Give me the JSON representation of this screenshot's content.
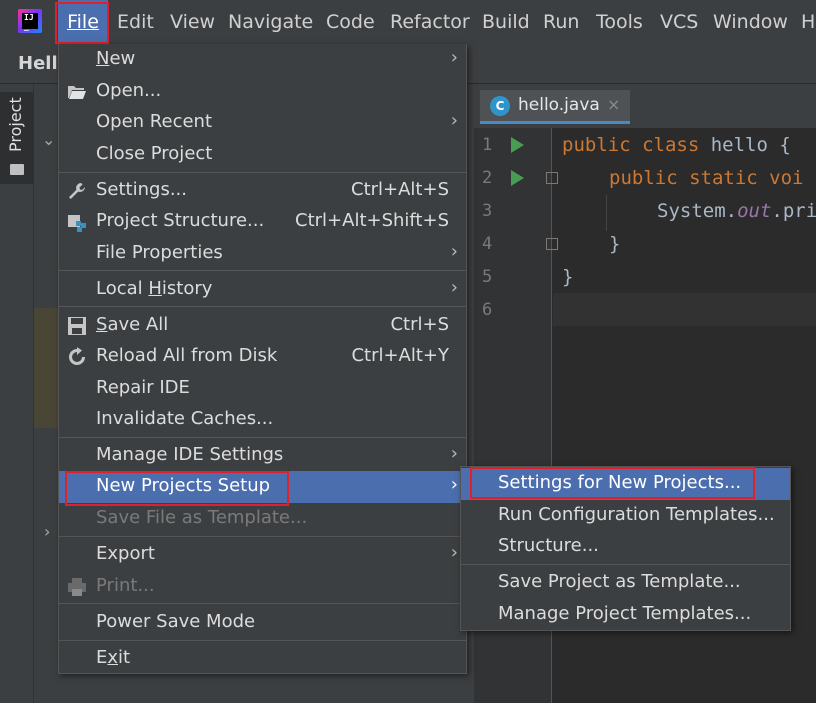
{
  "menubar": {
    "items": [
      {
        "label": "File",
        "mnemonic": "F"
      },
      {
        "label": "Edit"
      },
      {
        "label": "View"
      },
      {
        "label": "Navigate"
      },
      {
        "label": "Code"
      },
      {
        "label": "Refactor"
      },
      {
        "label": "Build"
      },
      {
        "label": "Run"
      },
      {
        "label": "Tools"
      },
      {
        "label": "VCS"
      },
      {
        "label": "Window"
      },
      {
        "label": "H"
      }
    ]
  },
  "window": {
    "title": "Hello"
  },
  "tool_window": {
    "project_tab": "Project"
  },
  "editor": {
    "tab_label": "hello.java",
    "tab_icon_letter": "C",
    "line_numbers": [
      "1",
      "2",
      "3",
      "4",
      "5",
      "6"
    ],
    "code": {
      "l1_kw": "public class",
      "l1_rest": " hello {",
      "l2_kw": "public static voi",
      "l3_a": "System.",
      "l3_b": "out",
      "l3_c": ".pri",
      "l4": "}",
      "l5": "}"
    }
  },
  "file_menu": {
    "new": "New",
    "open": "Open...",
    "open_recent": "Open Recent",
    "close_project": "Close Project",
    "settings": "Settings...",
    "settings_sc": "Ctrl+Alt+S",
    "project_structure": "Project Structure...",
    "project_structure_sc": "Ctrl+Alt+Shift+S",
    "file_properties": "File Properties",
    "local_history": "Local History",
    "save_all": "Save All",
    "save_all_sc": "Ctrl+S",
    "reload": "Reload All from Disk",
    "reload_sc": "Ctrl+Alt+Y",
    "repair_ide": "Repair IDE",
    "invalidate_caches": "Invalidate Caches...",
    "manage_ide_settings": "Manage IDE Settings",
    "new_projects_setup": "New Projects Setup",
    "save_file_as_template": "Save File as Template...",
    "export": "Export",
    "print": "Print...",
    "power_save_mode": "Power Save Mode",
    "exit": "Exit"
  },
  "submenu": {
    "settings_new_projects": "Settings for New Projects...",
    "run_config_templates": "Run Configuration Templates...",
    "structure": "Structure...",
    "save_project_template": "Save Project as Template...",
    "manage_project_templates": "Manage Project Templates..."
  },
  "colors": {
    "selection": "#4b6eaf",
    "highlight_box": "#e0202a",
    "menu_bg": "#3c3f41",
    "editor_bg": "#2b2b2b"
  }
}
